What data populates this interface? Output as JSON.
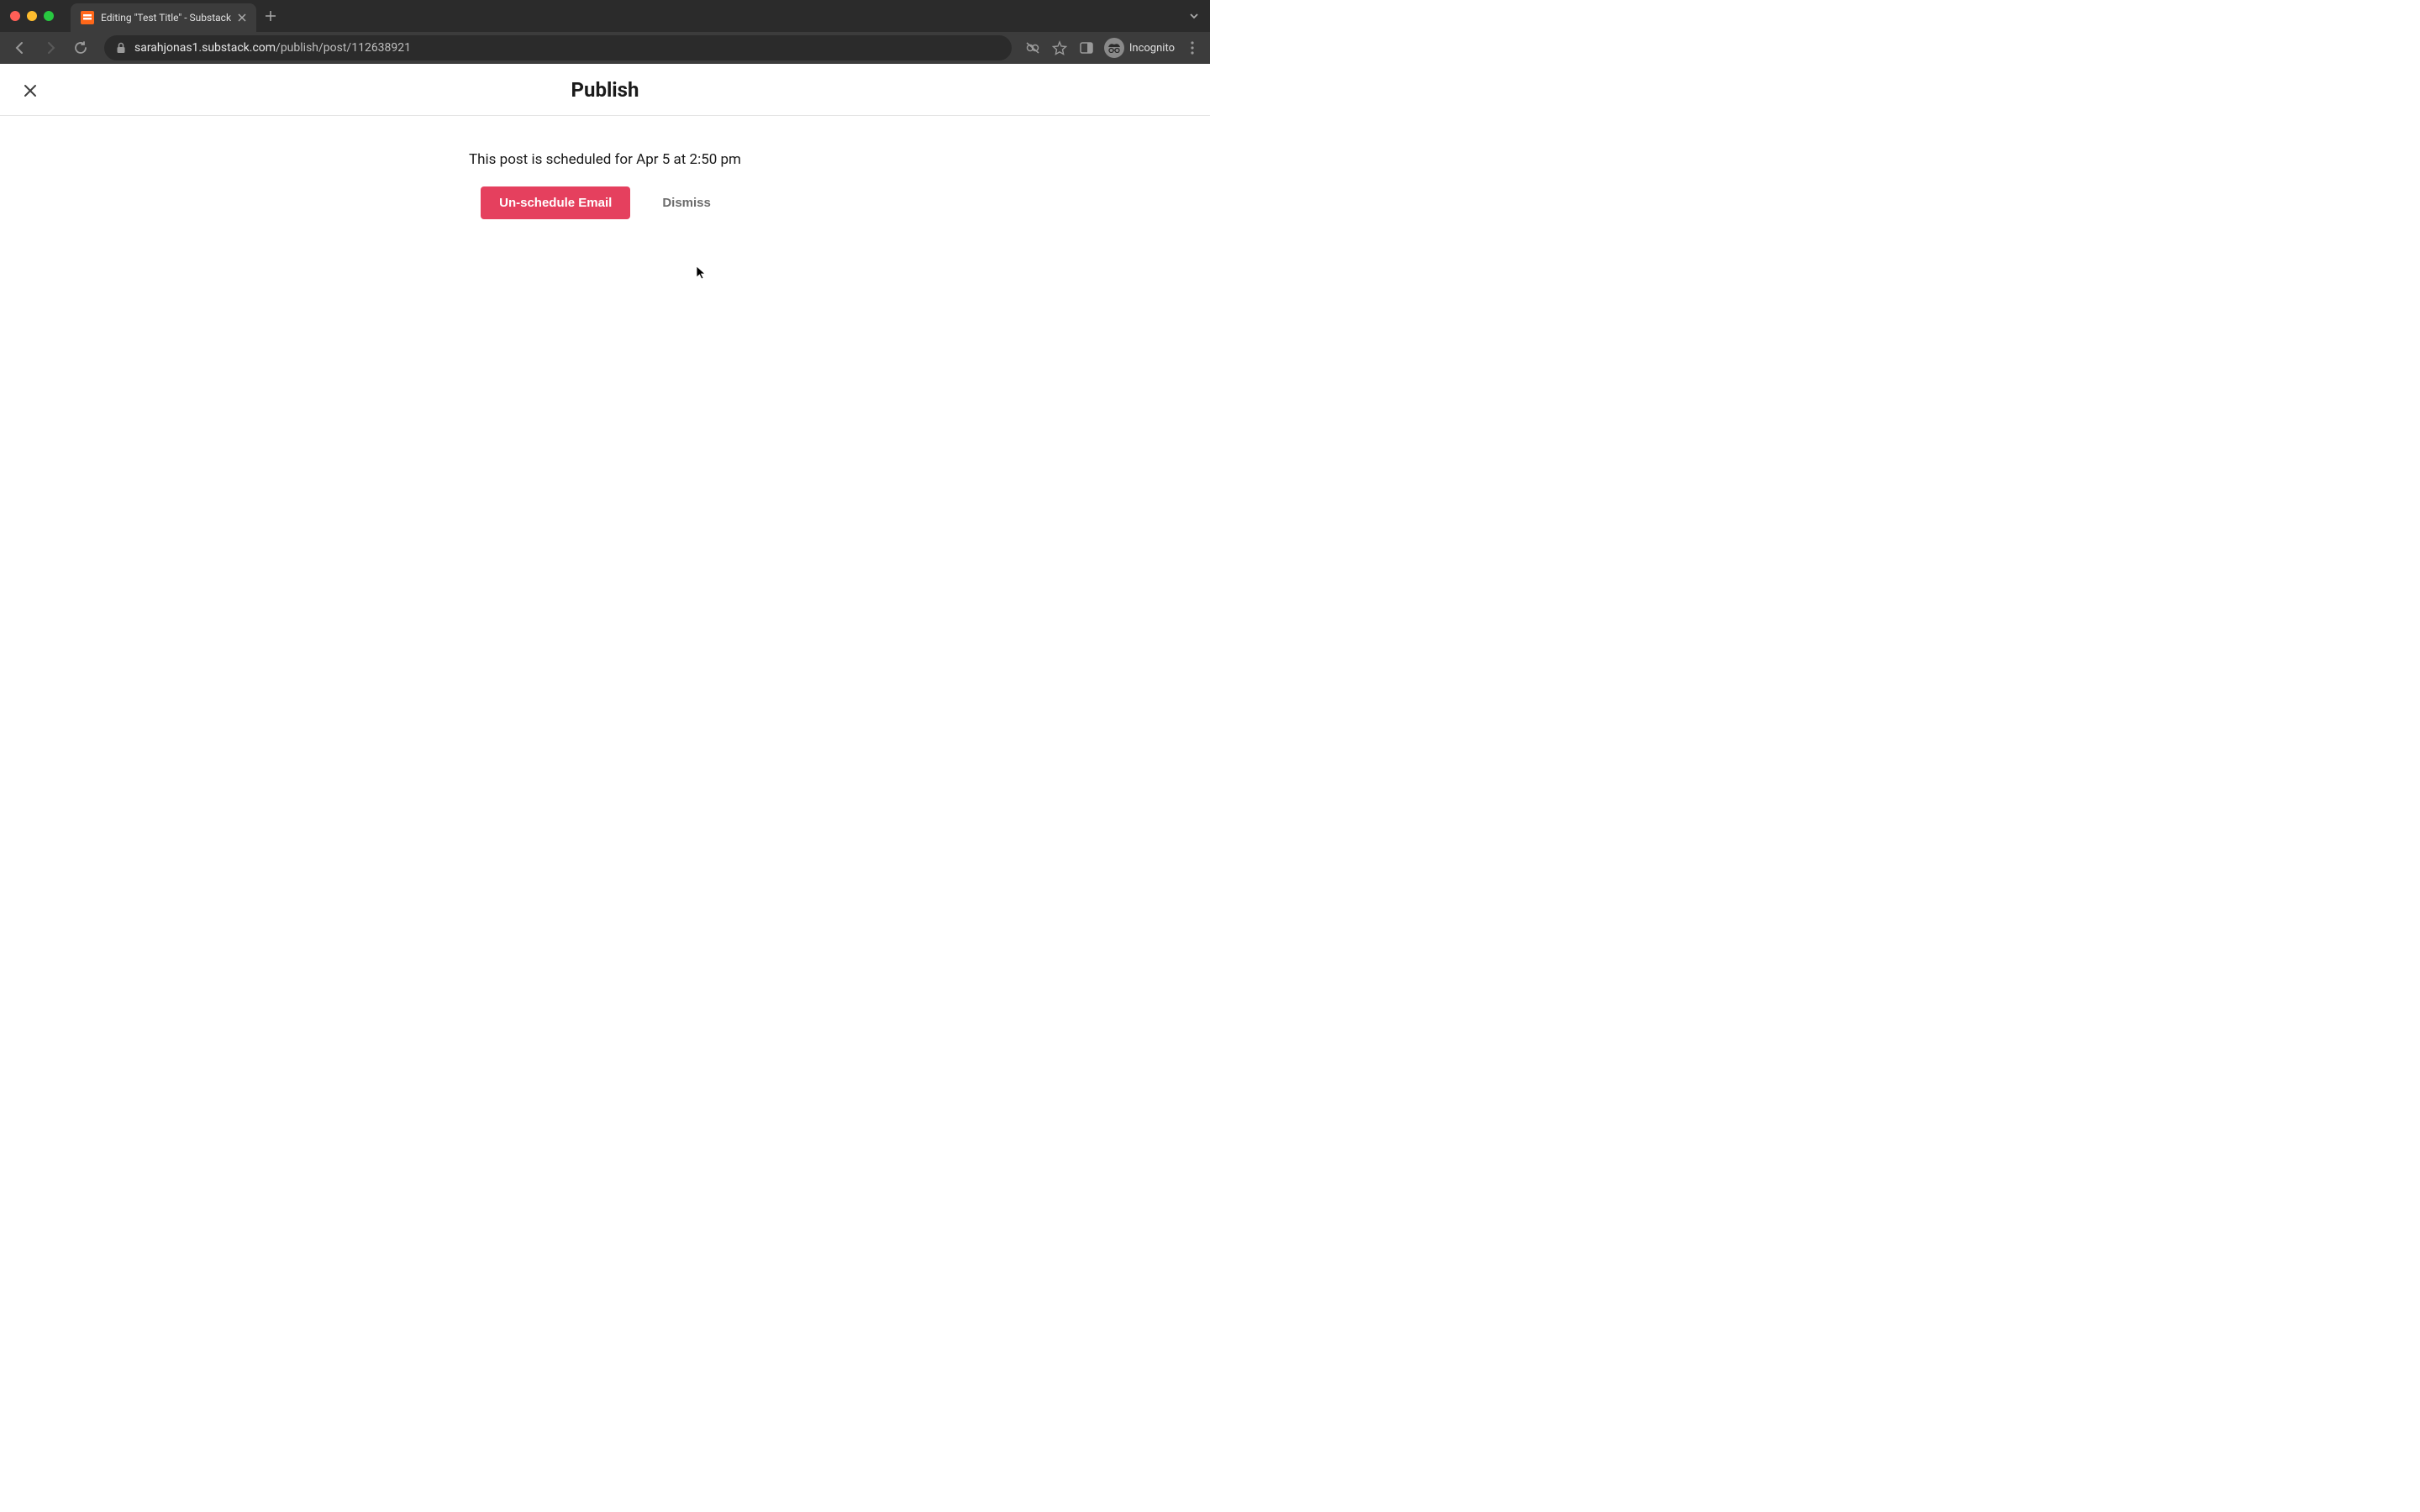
{
  "browser": {
    "tab_title": "Editing \"Test Title\" - Substack",
    "url_domain": "sarahjonas1.substack.com",
    "url_path": "/publish/post/112638921",
    "incognito_label": "Incognito"
  },
  "page": {
    "title": "Publish",
    "schedule_message": "This post is scheduled for Apr 5 at 2:50 pm",
    "unschedule_label": "Un-schedule Email",
    "dismiss_label": "Dismiss"
  }
}
